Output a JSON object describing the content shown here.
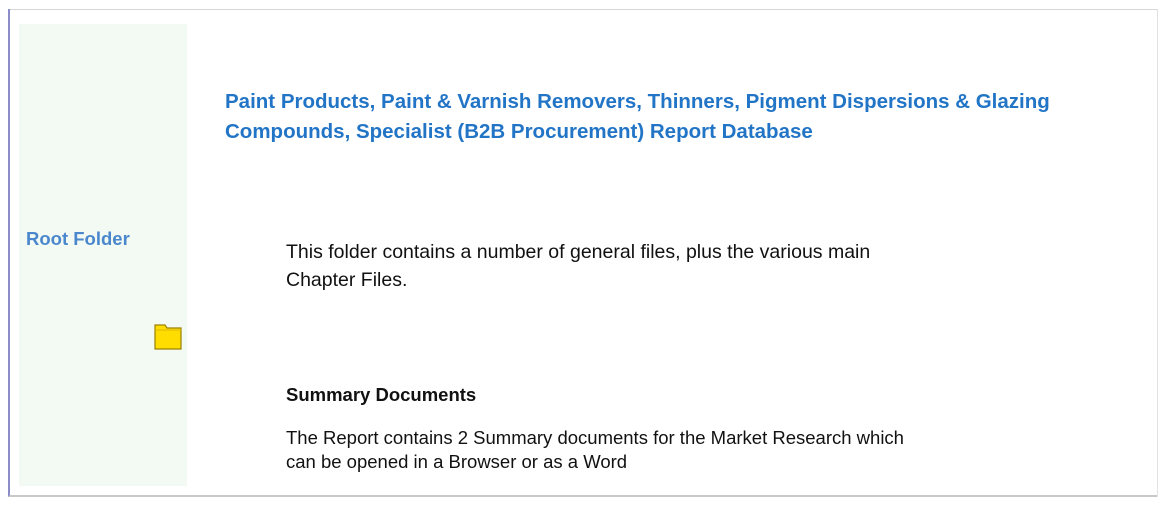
{
  "sidebar": {
    "label": "Root Folder",
    "icon": "folder-icon"
  },
  "main": {
    "title": "Paint Products, Paint & Varnish Removers, Thinners, Pigment Dispersions & Glazing Compounds, Specialist (B2B Procurement) Report Database",
    "intro": "This folder contains a number of general files, plus the various main Chapter Files.",
    "section": {
      "heading": "Summary Documents",
      "body": "The Report contains 2 Summary documents for the Market Research which can be opened in a Browser or as a Word"
    }
  },
  "colors": {
    "sidebar_bg": "#f3f9f3",
    "accent_blue": "#2275c6",
    "sidebar_label": "#4a87cc",
    "folder_yellow": "#ffdd00"
  }
}
